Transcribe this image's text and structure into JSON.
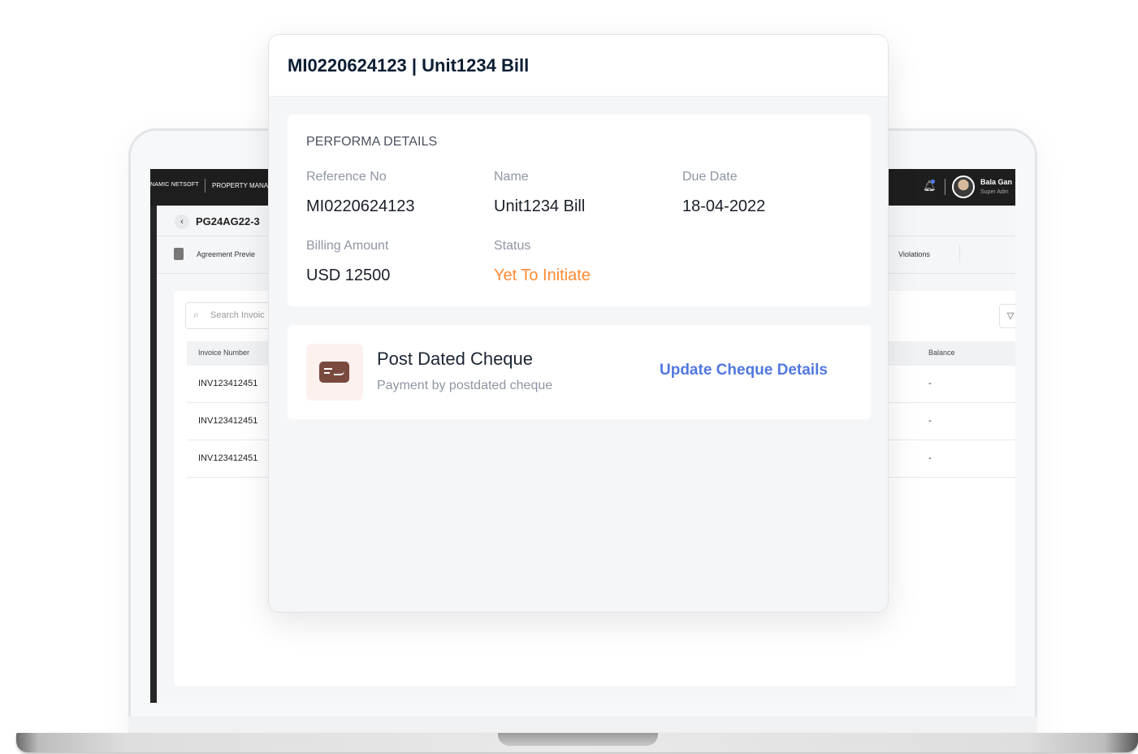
{
  "app": {
    "brand": "NAMIC NETSOFT",
    "module": "PROPERTY MANA",
    "user_name": "Bala Gan",
    "user_role": "Super Adm",
    "breadcrumb_title": "PG24AG22-3",
    "tabs": {
      "agreement_preview": "Agreement Previe",
      "violations": "Violations"
    },
    "search_placeholder": "Search Invoic",
    "table": {
      "headers": {
        "invoice_number": "Invoice Number",
        "balance": "Balance"
      },
      "rows": [
        {
          "invoice": "INV123412451",
          "balance": "-"
        },
        {
          "invoice": "INV123412451",
          "balance": "-"
        },
        {
          "invoice": "INV123412451",
          "balance": "-"
        }
      ]
    }
  },
  "modal": {
    "title": "MI0220624123 | Unit1234 Bill",
    "performa": {
      "section_title": "PERFORMA DETAILS",
      "reference_label": "Reference No",
      "reference_value": "MI0220624123",
      "name_label": "Name",
      "name_value": "Unit1234 Bill",
      "due_label": "Due Date",
      "due_value": "18-04-2022",
      "amount_label": "Billing Amount",
      "amount_value": "USD 12500",
      "status_label": "Status",
      "status_value": "Yet To Initiate",
      "status_color": "#ff8a33"
    },
    "cheque": {
      "icon": "cheque-icon",
      "title": "Post Dated Cheque",
      "subtitle": "Payment by postdated cheque",
      "action": "Update Cheque Details",
      "action_color": "#5278e0"
    }
  }
}
